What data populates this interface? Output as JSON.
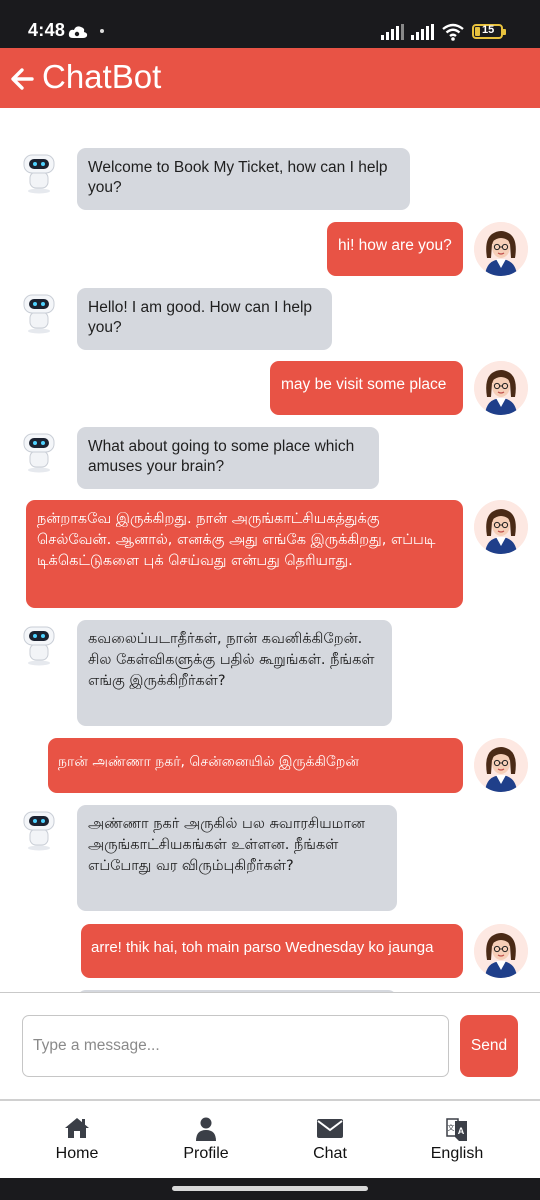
{
  "status_bar": {
    "time": "4:48",
    "battery": "15",
    "icons": [
      "cloud-icon",
      "dot-icon",
      "signal-icon",
      "signal-icon",
      "wifi-icon",
      "battery-icon"
    ]
  },
  "header": {
    "back_icon": "back-arrow-icon",
    "title": "ChatBot",
    "color": "#e85345"
  },
  "messages": [
    {
      "sender": "bot",
      "text": "Welcome to Book My Ticket, how can I help you?"
    },
    {
      "sender": "user",
      "text": "hi! how are you?"
    },
    {
      "sender": "bot",
      "text": "Hello! I am good. How can I help you?"
    },
    {
      "sender": "user",
      "text": "may be visit some place"
    },
    {
      "sender": "bot",
      "text": "What about going to some place which amuses your brain?"
    },
    {
      "sender": "user",
      "text": "நன்றாகவே இருக்கிறது. நான் அருங்காட்சியகத்துக்கு செல்வேன். ஆனால், எனக்கு அது எங்கே இருக்கிறது, எப்படி டிக்கெட்டுகளை புக் செய்வது என்பது தெரியாது."
    },
    {
      "sender": "bot",
      "text": "கவலைப்படாதீர்கள், நான் கவனிக்கிறேன். சில கேள்விகளுக்கு பதில் கூறுங்கள். நீங்கள் எங்கு இருக்கிறீர்கள்?"
    },
    {
      "sender": "user",
      "text": "நான் அண்ணா நகர், சென்னையில் இருக்கிறேன்"
    },
    {
      "sender": "bot",
      "text": "அண்ணா நகர் அருகில் பல சுவாரசியமான அருங்காட்சியகங்கள் உள்ளன. நீங்கள் எப்போது வர விரும்புகிறீர்கள்?"
    },
    {
      "sender": "user",
      "text": "arre! thik hai, toh main parso Wednesday ko jaunga"
    }
  ],
  "composer": {
    "placeholder": "Type a message...",
    "value": "",
    "send_label": "Send"
  },
  "tabs": [
    {
      "label": "Home",
      "icon": "home-icon"
    },
    {
      "label": "Profile",
      "icon": "profile-icon"
    },
    {
      "label": "Chat",
      "icon": "envelope-icon"
    },
    {
      "label": "English",
      "icon": "translate-icon"
    }
  ]
}
